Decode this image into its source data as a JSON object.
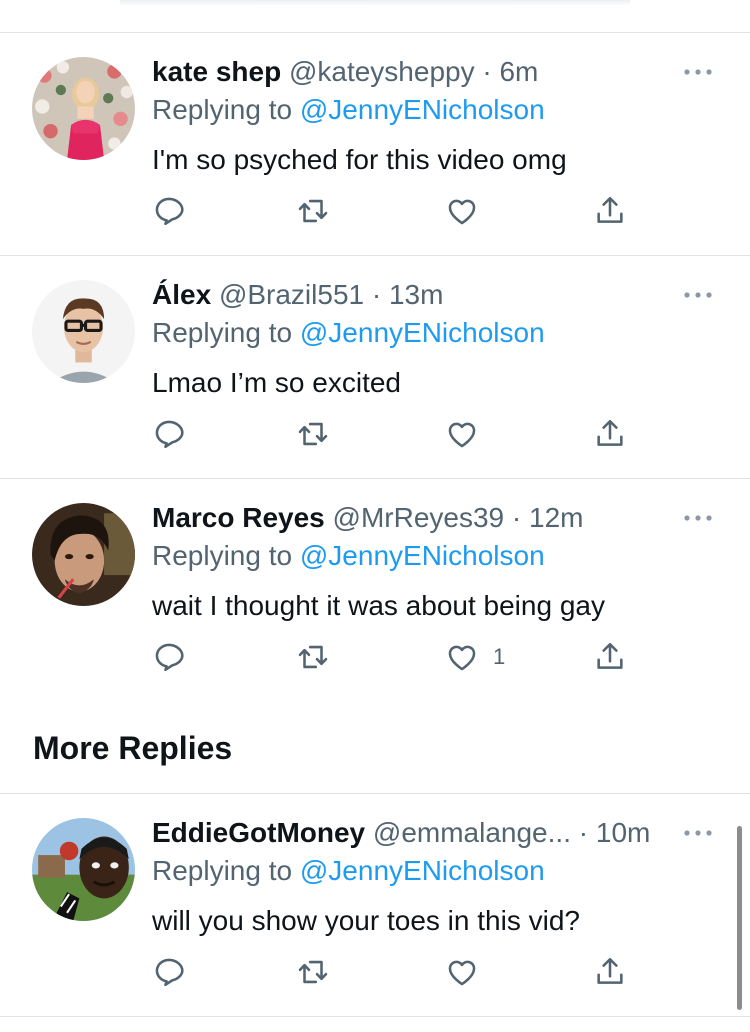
{
  "tweets": [
    {
      "name": "kate shep",
      "handle": "@kateysheppy",
      "time": "6m",
      "replying_label": "Replying to",
      "replying_to": "@JennyENicholson",
      "text": "I'm so psyched for this video omg",
      "like_count": ""
    },
    {
      "name": "Álex",
      "handle": "@Brazil551",
      "time": "13m",
      "replying_label": "Replying to",
      "replying_to": "@JennyENicholson",
      "text": "Lmao I’m so excited",
      "like_count": ""
    },
    {
      "name": "Marco Reyes",
      "handle": "@MrReyes39",
      "time": "12m",
      "replying_label": "Replying to",
      "replying_to": "@JennyENicholson",
      "text": "wait I thought it was about being gay",
      "like_count": "1"
    },
    {
      "name": "EddieGotMoney",
      "handle": "@emmalange...",
      "time": "10m",
      "replying_label": "Replying to",
      "replying_to": "@JennyENicholson",
      "text": "will you show your toes in this vid?",
      "like_count": ""
    }
  ],
  "more_replies_title": "More Replies",
  "separator": " · ",
  "colors": {
    "accent": "#1d9bf0",
    "secondary_text": "#536471",
    "divider": "#dfe3e6"
  },
  "icons": [
    "more-icon",
    "reply-icon",
    "retweet-icon",
    "like-icon",
    "share-icon"
  ]
}
